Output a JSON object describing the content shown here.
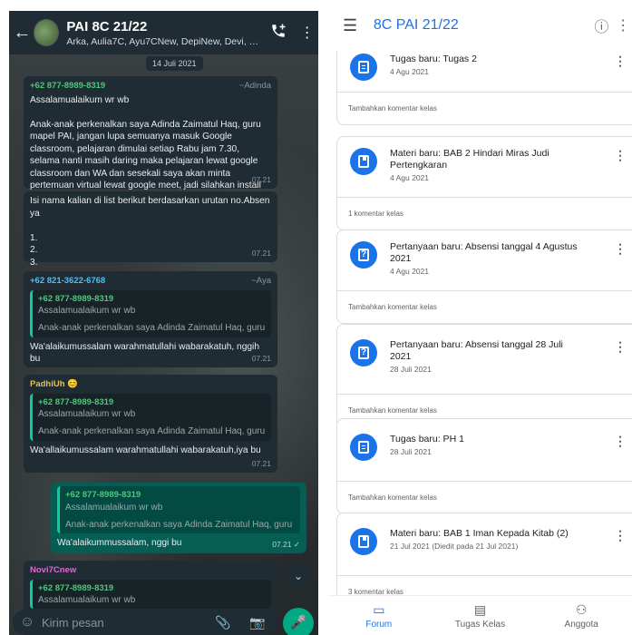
{
  "whatsapp": {
    "title": "PAI 8C 21/22",
    "subtitle": "Arka, Aulia7C, Ayu7CNew, DepiNew, Devi, End...",
    "date_chip": "14 Juli 2021",
    "messages": [
      {
        "sender": "+62 877-8989-8319",
        "nick": "~Adinda",
        "text": "Assalamualaikum wr wb\n\nAnak-anak perkenalkan saya Adinda Zaimatul Haq, guru mapel PAI, jangan lupa semuanya masuk Google classroom, pelajaran dimulai setiap Rabu jam 7.30, selama nanti masih daring maka pelajaran lewat google classroom dan WA dan sesekali saya akan minta pertemuan virtual lewat google meet, jadi silahkan install Google meet ya 🙏",
        "time": "07.21"
      },
      {
        "text": "Isi nama kalian di list berikut berdasarkan urutan no.Absen ya\n\n1.\n2.\n3.",
        "time": "07.21"
      },
      {
        "sender": "+62 821-3622-6768",
        "nick": "~Aya",
        "quote_sender": "+62 877-8989-8319",
        "quote_line1": "Assalamualaikum wr wb",
        "quote_line2": "Anak-anak perkenalkan saya Adinda Zaimatul Haq, guru ...",
        "text": "Wa'alaikumussalam warahmatullahi wabarakatuh, nggih bu",
        "time": "07.21"
      },
      {
        "sender": "PadhiUh 😊",
        "quote_sender": "+62 877-8989-8319",
        "quote_line1": "Assalamualaikum wr wb",
        "quote_line2": "Anak-anak perkenalkan saya Adinda Zaimatul Haq, guru mapel PAI, jangan lupa semuanya masuk Google cla...",
        "text": "Wa'allaikumussalam warahmatullahi wabarakatuh,iya bu",
        "time": "07.21"
      },
      {
        "quote_sender": "+62 877-8989-8319",
        "quote_line1": "Assalamualaikum wr wb",
        "quote_line2": "Anak-anak perkenalkan saya Adinda Zaimatul Haq, guru ...",
        "text": "Wa'alaikummussalam, nggi bu",
        "time": "07.21 ✓"
      },
      {
        "sender": "Novi7Cnew",
        "quote_sender": "+62 877-8989-8319",
        "quote_line1": "Assalamualaikum wr wb"
      }
    ],
    "input_placeholder": "Kirim pesan",
    "colors": {
      "header": "#1f2c33",
      "incoming": "#1f2c33",
      "outgoing": "#055e54",
      "accent": "#00a884"
    }
  },
  "classroom": {
    "title": "8C PAI 21/22",
    "cards": [
      {
        "type": "task",
        "title": "Tugas baru: Tugas 2",
        "date": "4 Agu 2021",
        "footer": "Tambahkan komentar kelas"
      },
      {
        "type": "material",
        "title": "Materi baru: BAB 2 Hindari Miras Judi Pertengkaran",
        "date": "4 Agu 2021",
        "footer": "1 komentar kelas"
      },
      {
        "type": "question",
        "title": "Pertanyaan baru: Absensi tanggal 4 Agustus 2021",
        "date": "4 Agu 2021",
        "footer": "Tambahkan komentar kelas"
      },
      {
        "type": "question",
        "title": "Pertanyaan baru: Absensi tanggal 28 Juli 2021",
        "date": "28 Juli 2021",
        "footer": "Tambahkan komentar kelas"
      },
      {
        "type": "task",
        "title": "Tugas baru: PH 1",
        "date": "28 Juli 2021",
        "footer": "Tambahkan komentar kelas"
      },
      {
        "type": "material",
        "title": "Materi baru: BAB 1 Iman Kepada Kitab (2)",
        "date": "21 Jul 2021 (Diedit pada 21 Jul 2021)",
        "footer": "3 komentar kelas"
      }
    ],
    "nav": [
      {
        "label": "Forum",
        "icon": "forum-icon",
        "active": true
      },
      {
        "label": "Tugas Kelas",
        "icon": "classwork-icon",
        "active": false
      },
      {
        "label": "Anggota",
        "icon": "people-icon",
        "active": false
      }
    ],
    "colors": {
      "accent": "#1a73e8"
    }
  }
}
